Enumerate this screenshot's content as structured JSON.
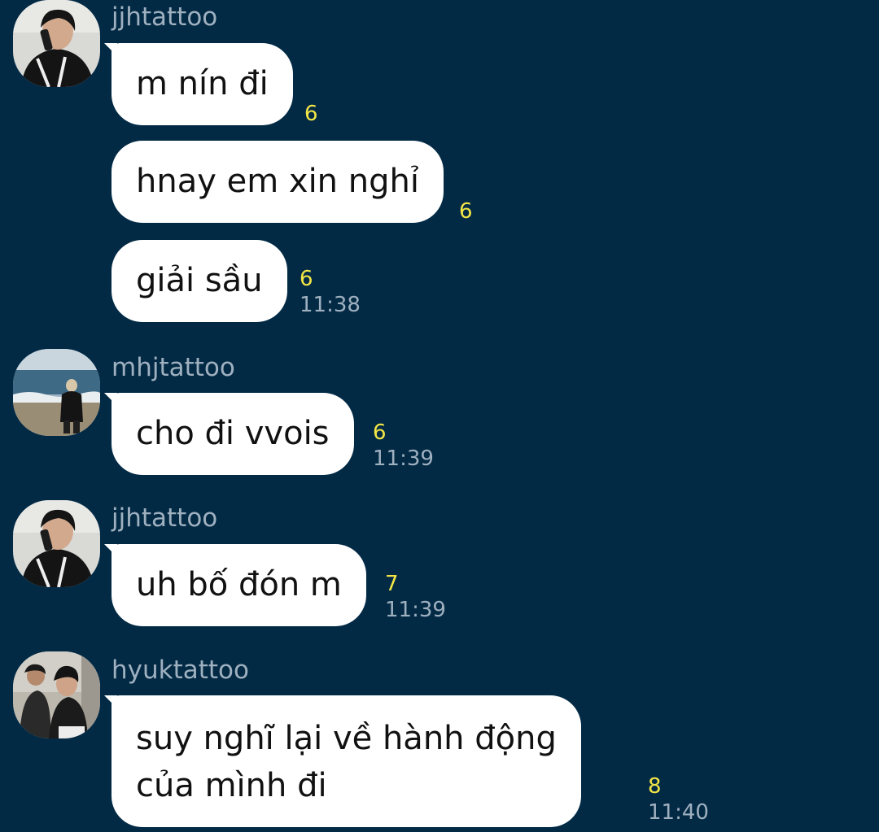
{
  "groups": [
    {
      "sender": "jjhtattoo",
      "avatar_icon": "avatar-jjhtattoo",
      "messages": [
        {
          "text": "m nín đi",
          "unread": "6",
          "time": ""
        },
        {
          "text": "hnay em xin nghỉ",
          "unread": "6",
          "time": ""
        },
        {
          "text": "giải sầu",
          "unread": "6",
          "time": "11:38"
        }
      ]
    },
    {
      "sender": "mhjtattoo",
      "avatar_icon": "avatar-mhjtattoo",
      "messages": [
        {
          "text": "cho đi vvois",
          "unread": "6",
          "time": "11:39"
        }
      ]
    },
    {
      "sender": "jjhtattoo",
      "avatar_icon": "avatar-jjhtattoo",
      "messages": [
        {
          "text": "uh bố đón m",
          "unread": "7",
          "time": "11:39"
        }
      ]
    },
    {
      "sender": "hyuktattoo",
      "avatar_icon": "avatar-hyuktattoo",
      "messages": [
        {
          "text": "suy nghĩ lại về hành động",
          "text2": "của mình đi",
          "unread": "8",
          "time": "11:40"
        }
      ]
    }
  ],
  "colors": {
    "background": "#022a45",
    "bubble": "#ffffff",
    "unread": "#f3e646",
    "muted": "#9fb0bf"
  }
}
